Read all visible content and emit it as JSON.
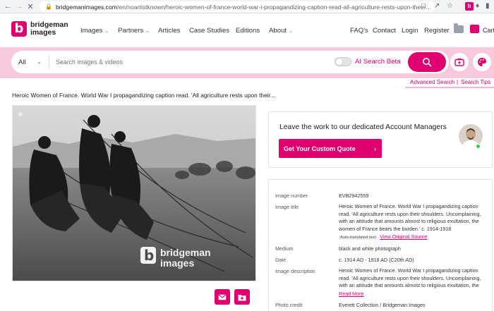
{
  "browser": {
    "url_domain": "bridgemanimages.com",
    "url_path": "/en/noartistknown/heroic-women-of-france-world-war-i-propagandizing-caption-read-all-agriculture-rests-upon-their/...",
    "right_label": "Cart"
  },
  "brand": {
    "accent": "#e0006f",
    "pink_band": "#f8c9dd",
    "logo_line1": "bridgeman",
    "logo_line2": "images"
  },
  "nav": {
    "images": "Images",
    "partners": "Partners",
    "articles": "Articles",
    "case_studies": "Case Studies",
    "editions": "Editions",
    "about": "About",
    "faqs": "FAQ's",
    "contact": "Contact",
    "login": "Login",
    "register": "Register",
    "cart": "Cart"
  },
  "search": {
    "scope": "All",
    "placeholder": "Search images & videos",
    "ai_label": "AI Search Beta",
    "advanced": "Advanced Search",
    "separator": "|",
    "tips": "Search Tips"
  },
  "page": {
    "caption": "Heroic Women of France. World War I propagandizing caption read. 'All agriculture rests upon their...",
    "watermark_line1": "bridgeman",
    "watermark_line2": "images"
  },
  "account": {
    "title": "Leave the work to our dedicated Account Managers",
    "button": "Get Your Custom Quote",
    "arrow": "›"
  },
  "details": {
    "image_number_label": "Image number",
    "image_number": "EVB2942559",
    "title_label": "Image title",
    "title_value": "Heroic Women of France. World War I propagandizing caption read. 'All agriculture rests upon their shoulders. Uncomplaining, with an attitude that amounts almost to religious exultation, the women of France bears the burden.' c. 1914-1918",
    "auto_translated": "Auto-translated text",
    "view_original": "View Original Source",
    "medium_label": "Medium",
    "medium": "black and white photograph",
    "date_label": "Date",
    "date": "c. 1914 AD - 1918 AD (C20th AD)",
    "description_label": "Image description",
    "description": "Heroic Women of France. World War I propagandizing caption read. 'All agriculture rests upon their shoulders. Uncomplaining, with an attitude that amounts almost to religious exultation, the",
    "read_more": "Read More",
    "credit_label": "Photo credit",
    "credit": "Everett Collection / Bridgeman Images"
  },
  "icons": {
    "back": "arrow-left-icon",
    "forward": "arrow-right-icon",
    "reload": "close-icon",
    "search": "search-icon",
    "camera": "camera-search-icon",
    "palette": "palette-icon",
    "email": "email-icon",
    "add_to_folder": "add-to-lightbox-icon"
  }
}
